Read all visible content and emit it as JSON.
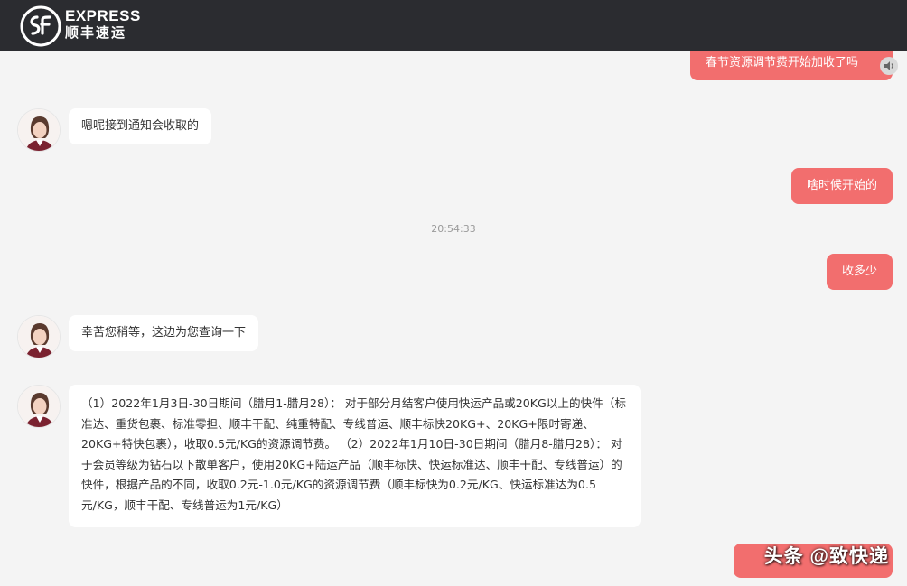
{
  "header": {
    "logo_en": "EXPRESS",
    "logo_cn": "顺丰速运"
  },
  "messages": [
    {
      "side": "right",
      "text": "春节资源调节费开始加收了吗"
    },
    {
      "side": "left",
      "text": "嗯呢接到通知会收取的"
    },
    {
      "side": "right",
      "text": "啥时候开始的"
    },
    {
      "side": "right",
      "text": "收多少"
    },
    {
      "side": "left",
      "text": "幸苦您稍等，这边为您查询一下"
    },
    {
      "side": "left",
      "text": "（1）2022年1月3日-30日期间（腊月1-腊月28）： 对于部分月结客户使用快运产品或20KG以上的快件（标准达、重货包裹、标准零担、顺丰干配、纯重特配、专线普运、顺丰标快20KG+、20KG+限时寄递、20KG+特快包裹），收取0.5元/KG的资源调节费。 （2）2022年1月10日-30日期间（腊月8-腊月28）： 对于会员等级为钻石以下散单客户，使用20KG+陆运产品（顺丰标快、快运标准达、顺丰干配、专线普运）的快件，根据产品的不同，收取0.2元-1.0元/KG的资源调节费（顺丰标快为0.2元/KG、快运标准达为0.5元/KG，顺丰干配、专线普运为1元/KG）"
    }
  ],
  "timestamp": "20:54:33",
  "watermark": "头条 @致快递",
  "colors": {
    "header_bg": "#2b2c30",
    "user_bubble": "#f26e6e",
    "agent_bubble": "#ffffff",
    "chat_bg": "#f4f4f4"
  },
  "icons": {
    "logo": "sf-logo-icon",
    "speaker": "speaker-icon",
    "avatar": "agent-avatar"
  }
}
